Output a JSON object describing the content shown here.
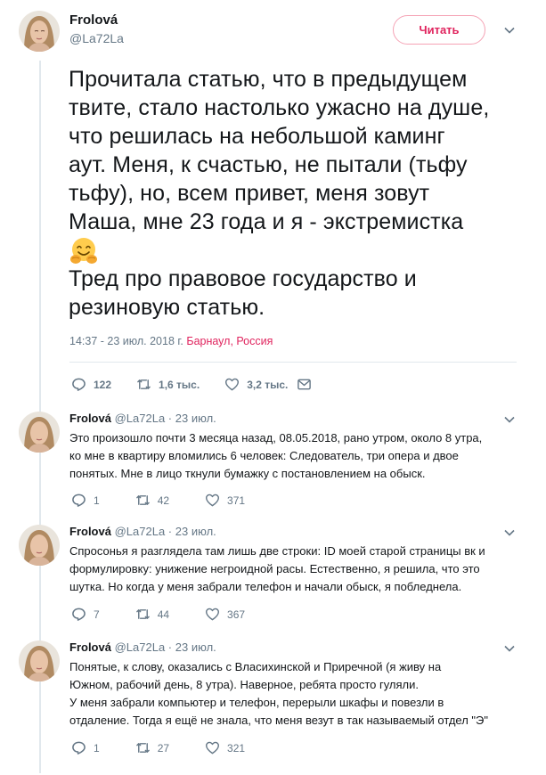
{
  "main_tweet": {
    "name": "Frolová",
    "handle": "@La72La",
    "follow_label": "Читать",
    "text_lines": [
      "Прочитала статью, что в предыдущем",
      "твите, стало настолько ужасно на душе,",
      "что решилась на небольшой каминг",
      "аут. Меня, к счастью, не пытали (тьфу",
      "тьфу), но, всем привет, меня зовут",
      "Маша, мне 23 года и я - экстремистка"
    ],
    "text_line2": [
      "Тред про правовое государство и",
      "резиновую статью."
    ],
    "emoji": "hugging-face-emoji",
    "timestamp": "14:37 - 23 июл. 2018 г.",
    "location": "Барнаул, Россия",
    "replies": "122",
    "retweets": "1,6 тыс.",
    "likes": "3,2 тыс."
  },
  "replies": [
    {
      "name": "Frolová",
      "handle": "@La72La",
      "date": "23 июл.",
      "lines": [
        "Это произошло почти 3 месяца назад, 08.05.2018, рано утром, около 8 утра,",
        "ко мне в квартиру вломились 6 человек: Следователь, три опера и двое",
        "понятых. Мне в лицо ткнули бумажку с постановлением на обыск."
      ],
      "replies": "1",
      "retweets": "42",
      "likes": "371"
    },
    {
      "name": "Frolová",
      "handle": "@La72La",
      "date": "23 июл.",
      "lines": [
        "Спросонья я разглядела там лишь две строки: ID моей старой страницы вк и",
        "формулировку: унижение негроидной расы. Естественно, я решила, что это",
        "шутка. Но когда у меня забрали телефон и начали обыск, я побледнела."
      ],
      "replies": "7",
      "retweets": "44",
      "likes": "367"
    },
    {
      "name": "Frolová",
      "handle": "@La72La",
      "date": "23 июл.",
      "lines": [
        "Понятые, к слову, оказались с Власихинской и Приречной (я живу на",
        "Южном, рабочий день, 8 утра). Наверное, ребята просто гуляли.",
        "У меня забрали компьютер и телефон, перерыли шкафы и повезли в",
        "отдаление. Тогда я ещё не знала, что меня везут в так называемый отдел \"Э\""
      ],
      "replies": "1",
      "retweets": "27",
      "likes": "321"
    }
  ]
}
